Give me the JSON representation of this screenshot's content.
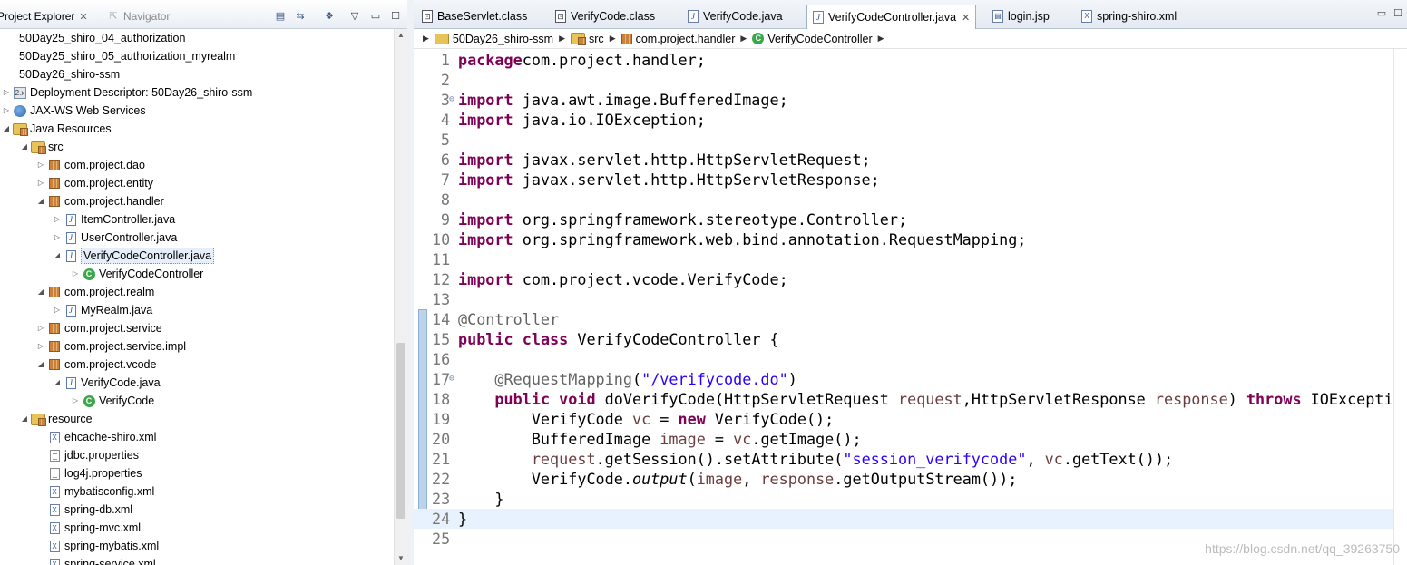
{
  "left_panel": {
    "tabs": [
      {
        "label": "Project Explorer",
        "active": true
      },
      {
        "label": "Navigator",
        "active": false
      }
    ],
    "toolbar_icons": [
      "collapse-all-icon",
      "link-with-editor-icon",
      "focus-icon",
      "view-menu-icon",
      "minimize-icon"
    ],
    "tree": [
      {
        "label": "50Day25_shiro_04_authorization",
        "icon": "project",
        "depth": 0,
        "toggle": ""
      },
      {
        "label": "50Day25_shiro_05_authorization_myrealm",
        "icon": "project",
        "depth": 0,
        "toggle": ""
      },
      {
        "label": "50Day26_shiro-ssm",
        "icon": "project",
        "depth": 0,
        "toggle": ""
      },
      {
        "label": "Deployment Descriptor: 50Day26_shiro-ssm",
        "icon": "dd",
        "depth": 1,
        "toggle": "▷"
      },
      {
        "label": "JAX-WS Web Services",
        "icon": "ws",
        "depth": 1,
        "toggle": "▷"
      },
      {
        "label": "Java Resources",
        "icon": "src",
        "depth": 1,
        "toggle": "◢"
      },
      {
        "label": "src",
        "icon": "src",
        "depth": 2,
        "toggle": "◢"
      },
      {
        "label": "com.project.dao",
        "icon": "pkg",
        "depth": 3,
        "toggle": "▷"
      },
      {
        "label": "com.project.entity",
        "icon": "pkg",
        "depth": 3,
        "toggle": "▷"
      },
      {
        "label": "com.project.handler",
        "icon": "pkg",
        "depth": 3,
        "toggle": "◢"
      },
      {
        "label": "ItemController.java",
        "icon": "java",
        "depth": 4,
        "toggle": "▷"
      },
      {
        "label": "UserController.java",
        "icon": "java",
        "depth": 4,
        "toggle": "▷"
      },
      {
        "label": "VerifyCodeController.java",
        "icon": "java",
        "depth": 4,
        "toggle": "◢",
        "selected": true
      },
      {
        "label": "VerifyCodeController",
        "icon": "class",
        "depth": 5,
        "toggle": "▷"
      },
      {
        "label": "com.project.realm",
        "icon": "pkg",
        "depth": 3,
        "toggle": "◢"
      },
      {
        "label": "MyRealm.java",
        "icon": "java",
        "depth": 4,
        "toggle": "▷"
      },
      {
        "label": "com.project.service",
        "icon": "pkg",
        "depth": 3,
        "toggle": "▷"
      },
      {
        "label": "com.project.service.impl",
        "icon": "pkg",
        "depth": 3,
        "toggle": "▷"
      },
      {
        "label": "com.project.vcode",
        "icon": "pkg",
        "depth": 3,
        "toggle": "◢"
      },
      {
        "label": "VerifyCode.java",
        "icon": "java",
        "depth": 4,
        "toggle": "◢"
      },
      {
        "label": "VerifyCode",
        "icon": "class",
        "depth": 5,
        "toggle": "▷"
      },
      {
        "label": "resource",
        "icon": "src",
        "depth": 2,
        "toggle": "◢"
      },
      {
        "label": "ehcache-shiro.xml",
        "icon": "xml",
        "depth": 3,
        "toggle": ""
      },
      {
        "label": "jdbc.properties",
        "icon": "prop",
        "depth": 3,
        "toggle": ""
      },
      {
        "label": "log4j.properties",
        "icon": "prop",
        "depth": 3,
        "toggle": ""
      },
      {
        "label": "mybatisconfig.xml",
        "icon": "xml",
        "depth": 3,
        "toggle": ""
      },
      {
        "label": "spring-db.xml",
        "icon": "xml",
        "depth": 3,
        "toggle": ""
      },
      {
        "label": "spring-mvc.xml",
        "icon": "xml",
        "depth": 3,
        "toggle": ""
      },
      {
        "label": "spring-mybatis.xml",
        "icon": "xml",
        "depth": 3,
        "toggle": ""
      },
      {
        "label": "spring-service.xml",
        "icon": "xml",
        "depth": 3,
        "toggle": ""
      }
    ]
  },
  "editor": {
    "tabs": [
      {
        "label": "BaseServlet.class",
        "icon": "class-file"
      },
      {
        "label": "VerifyCode.class",
        "icon": "class-file"
      },
      {
        "label": "VerifyCode.java",
        "icon": "java"
      },
      {
        "label": "VerifyCodeController.java",
        "icon": "java",
        "active": true
      },
      {
        "label": "login.jsp",
        "icon": "jsp"
      },
      {
        "label": "spring-shiro.xml",
        "icon": "xml"
      }
    ],
    "breadcrumb": [
      "50Day26_shiro-ssm",
      "src",
      "com.project.handler",
      "VerifyCodeController"
    ],
    "current_line": 24,
    "lines": [
      {
        "n": "1",
        "fold": "",
        "tokens": [
          [
            "kw",
            "package"
          ],
          [
            "",
            "com.project.handler;"
          ]
        ]
      },
      {
        "n": "2",
        "fold": "",
        "tokens": []
      },
      {
        "n": "3",
        "fold": "⊖",
        "tokens": [
          [
            "kw",
            "import"
          ],
          [
            "",
            " java.awt.image.BufferedImage;"
          ]
        ]
      },
      {
        "n": "4",
        "fold": "",
        "tokens": [
          [
            "kw",
            "import"
          ],
          [
            "",
            " java.io.IOException;"
          ]
        ]
      },
      {
        "n": "5",
        "fold": "",
        "tokens": []
      },
      {
        "n": "6",
        "fold": "",
        "tokens": [
          [
            "kw",
            "import"
          ],
          [
            "",
            " javax.servlet.http.HttpServletRequest;"
          ]
        ]
      },
      {
        "n": "7",
        "fold": "",
        "tokens": [
          [
            "kw",
            "import"
          ],
          [
            "",
            " javax.servlet.http.HttpServletResponse;"
          ]
        ]
      },
      {
        "n": "8",
        "fold": "",
        "tokens": []
      },
      {
        "n": "9",
        "fold": "",
        "tokens": [
          [
            "kw",
            "import"
          ],
          [
            "",
            " org.springframework.stereotype.Controller;"
          ]
        ]
      },
      {
        "n": "10",
        "fold": "",
        "tokens": [
          [
            "kw",
            "import"
          ],
          [
            "",
            " org.springframework.web.bind.annotation.RequestMapping;"
          ]
        ]
      },
      {
        "n": "11",
        "fold": "",
        "tokens": []
      },
      {
        "n": "12",
        "fold": "",
        "tokens": [
          [
            "kw",
            "import"
          ],
          [
            "",
            " com.project.vcode.VerifyCode;"
          ]
        ]
      },
      {
        "n": "13",
        "fold": "",
        "tokens": []
      },
      {
        "n": "14",
        "fold": "",
        "tokens": [
          [
            "ann",
            "@Controller"
          ]
        ]
      },
      {
        "n": "15",
        "fold": "",
        "tokens": [
          [
            "kw",
            "public"
          ],
          [
            "",
            " "
          ],
          [
            "kw",
            "class"
          ],
          [
            "",
            " VerifyCodeController {"
          ]
        ]
      },
      {
        "n": "16",
        "fold": "",
        "tokens": []
      },
      {
        "n": "17",
        "fold": "⊖",
        "tokens": [
          [
            "",
            "    "
          ],
          [
            "ann",
            "@RequestMapping"
          ],
          [
            "",
            "("
          ],
          [
            "str",
            "\"/verifycode.do\""
          ],
          [
            "",
            ")"
          ]
        ]
      },
      {
        "n": "18",
        "fold": "",
        "tokens": [
          [
            "",
            "    "
          ],
          [
            "kw",
            "public"
          ],
          [
            "",
            " "
          ],
          [
            "kw",
            "void"
          ],
          [
            "",
            " doVerifyCode(HttpServletRequest "
          ],
          [
            "var",
            "request"
          ],
          [
            "",
            ",HttpServletResponse "
          ],
          [
            "var",
            "response"
          ],
          [
            "",
            ") "
          ],
          [
            "kw",
            "throws"
          ],
          [
            "",
            " IOExceptio"
          ]
        ]
      },
      {
        "n": "19",
        "fold": "",
        "tokens": [
          [
            "",
            "        VerifyCode "
          ],
          [
            "var",
            "vc"
          ],
          [
            "",
            " = "
          ],
          [
            "kw",
            "new"
          ],
          [
            "",
            " VerifyCode();"
          ]
        ]
      },
      {
        "n": "20",
        "fold": "",
        "tokens": [
          [
            "",
            "        BufferedImage "
          ],
          [
            "var",
            "image"
          ],
          [
            "",
            " = "
          ],
          [
            "var",
            "vc"
          ],
          [
            "",
            ".getImage();"
          ]
        ]
      },
      {
        "n": "21",
        "fold": "",
        "tokens": [
          [
            "",
            "        "
          ],
          [
            "var",
            "request"
          ],
          [
            "",
            ".getSession().setAttribute("
          ],
          [
            "str",
            "\"session_verifycode\""
          ],
          [
            "",
            ", "
          ],
          [
            "var",
            "vc"
          ],
          [
            "",
            ".getText());"
          ]
        ]
      },
      {
        "n": "22",
        "fold": "",
        "tokens": [
          [
            "",
            "        VerifyCode."
          ],
          [
            "it",
            "output"
          ],
          [
            "",
            "("
          ],
          [
            "var",
            "image"
          ],
          [
            "",
            ", "
          ],
          [
            "var",
            "response"
          ],
          [
            "",
            ".getOutputStream());"
          ]
        ]
      },
      {
        "n": "23",
        "fold": "",
        "tokens": [
          [
            "",
            "    }"
          ]
        ]
      },
      {
        "n": "24",
        "fold": "",
        "tokens": [
          [
            "",
            "}"
          ]
        ]
      },
      {
        "n": "25",
        "fold": "",
        "tokens": []
      }
    ]
  },
  "watermark": "https://blog.csdn.net/qq_39263750",
  "colors": {
    "keyword": "#7f0055",
    "string": "#2a00ff",
    "annotation": "#646464",
    "variable": "#6a3e3e",
    "current_line": "#e8f2fe"
  }
}
